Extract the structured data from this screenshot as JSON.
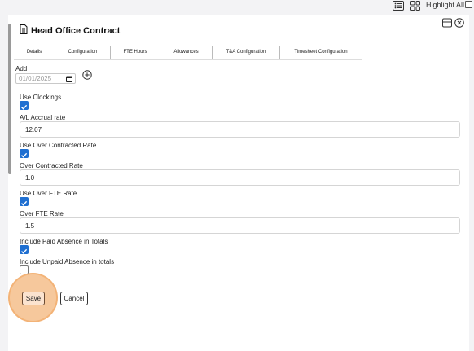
{
  "toolbar": {
    "highlight_label": "Highlight All",
    "highlight_checked": false
  },
  "header": {
    "title": "Head Office Contract"
  },
  "tabs": [
    {
      "label": "Details",
      "active": false
    },
    {
      "label": "Configuration",
      "active": false
    },
    {
      "label": "FTE Hours",
      "active": false
    },
    {
      "label": "Allowances",
      "active": false
    },
    {
      "label": "T&A Configuration",
      "active": true
    },
    {
      "label": "Timesheet Configuration",
      "active": false
    }
  ],
  "add": {
    "label": "Add",
    "date_value": "01/01/2025"
  },
  "form": {
    "use_clockings": {
      "label": "Use Clockings",
      "checked": true
    },
    "al_accrual_rate": {
      "label": "A/L Accrual rate",
      "value": "12.07"
    },
    "use_over_contracted_rate": {
      "label": "Use Over Contracted Rate",
      "checked": true
    },
    "over_contracted_rate": {
      "label": "Over Contracted Rate",
      "value": "1.0"
    },
    "use_over_fte_rate": {
      "label": "Use Over FTE Rate",
      "checked": true
    },
    "over_fte_rate": {
      "label": "Over FTE Rate",
      "value": "1.5"
    },
    "include_paid_absence": {
      "label": "Include Paid Absence in Totals",
      "checked": true
    },
    "include_unpaid_absence": {
      "label": "Include Unpaid Absence in totals",
      "checked": false
    }
  },
  "actions": {
    "save_label": "Save",
    "cancel_label": "Cancel"
  },
  "colors": {
    "checkbox": "#1f6fd1",
    "active_tab_underline": "#a0522d",
    "save_highlight": "#f6c89c"
  }
}
